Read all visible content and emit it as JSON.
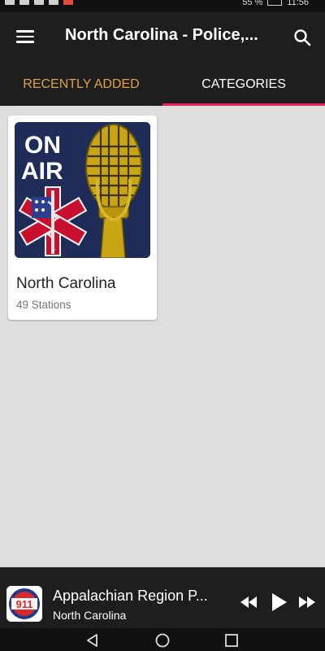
{
  "status_bar": {
    "battery": "55 %",
    "time": "11:56"
  },
  "app_bar": {
    "title": "North Carolina - Police,...",
    "menu_icon": "hamburger-menu-icon",
    "search_icon": "search-icon"
  },
  "tabs": [
    {
      "label": "RECENTLY ADDED",
      "active": false
    },
    {
      "label": "CATEGORIES",
      "active": true
    }
  ],
  "colors": {
    "app_bar_bg": "#1e1e1e",
    "inactive_tab": "#e0a04a",
    "tab_indicator": "#e8205e",
    "content_bg": "#dedede"
  },
  "categories": [
    {
      "title": "North Carolina",
      "subtitle": "49 Stations",
      "image_text_top": "ON",
      "image_text_bottom": "AIR"
    }
  ],
  "player": {
    "title": "Appalachian Region P...",
    "subtitle": "North Carolina",
    "art_text": "911",
    "controls": [
      "rewind-icon",
      "play-icon",
      "fast-forward-icon"
    ]
  },
  "nav_bar": [
    "back-icon",
    "home-icon",
    "recents-icon"
  ]
}
